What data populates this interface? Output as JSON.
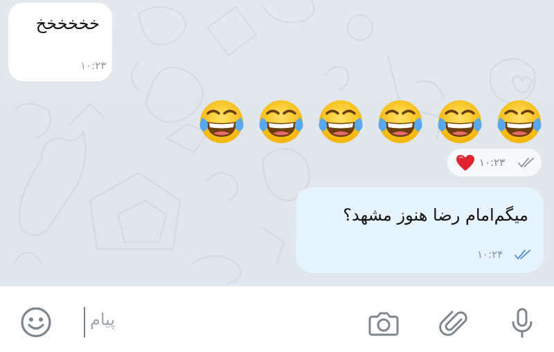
{
  "messages": {
    "incoming": {
      "text": "خخخخخخ",
      "time": "۱۰:۲۳"
    },
    "emoji_message": {
      "emojis": [
        "face-with-tears-of-joy",
        "face-with-tears-of-joy",
        "face-with-tears-of-joy",
        "face-with-tears-of-joy",
        "face-with-tears-of-joy",
        "face-with-tears-of-joy"
      ],
      "time": "۱۰:۲۳",
      "reaction": "heart-icon"
    },
    "outgoing": {
      "text": "میگم‌امام رضا هنوز مشهد؟",
      "time": "۱۰:۲۴"
    }
  },
  "composer": {
    "placeholder": "پیام",
    "icons": [
      "smiley-icon",
      "camera-icon",
      "paperclip-icon",
      "microphone-icon"
    ]
  },
  "colors": {
    "chat_background": "#dfe6ed",
    "outgoing_bubble": "#e6f3fc",
    "incoming_bubble": "#ffffff",
    "read_ticks": "#4a90d9",
    "heart": "#e0242f"
  }
}
